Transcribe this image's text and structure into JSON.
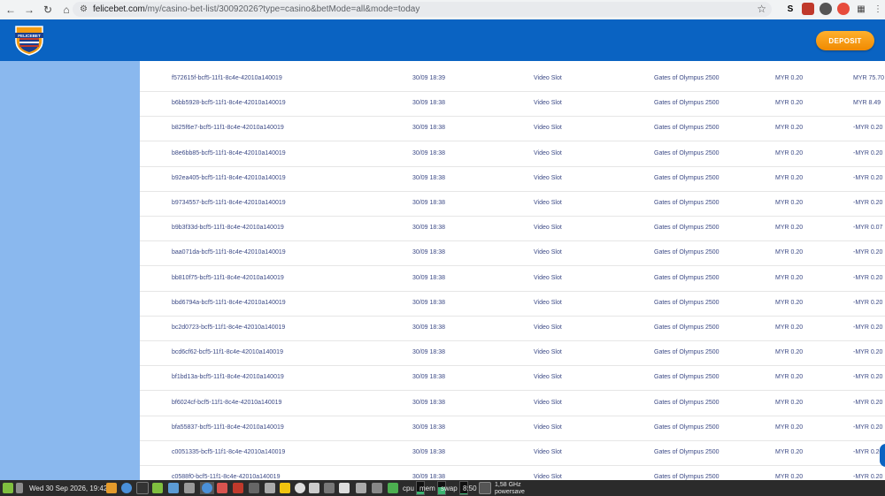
{
  "browser": {
    "url_host": "felicebet.com",
    "url_rest": "/my/casino-bet-list/30092026?type=casino&betMode=all&mode=today"
  },
  "header": {
    "logo_text": "FELICEBET",
    "deposit_label": "DEPOSIT"
  },
  "table": {
    "rows": [
      {
        "id": "f572615f-bcf5-11f1-8c4e-42010a140019",
        "time": "30/09 18:39",
        "type": "Video Slot",
        "game": "Gates of Olympus 2500",
        "bet": "MYR 0.20",
        "win": "MYR 75.70"
      },
      {
        "id": "b6bb5928-bcf5-11f1-8c4e-42010a140019",
        "time": "30/09 18:38",
        "type": "Video Slot",
        "game": "Gates of Olympus 2500",
        "bet": "MYR 0.20",
        "win": "MYR 8.49"
      },
      {
        "id": "b825f6e7-bcf5-11f1-8c4e-42010a140019",
        "time": "30/09 18:38",
        "type": "Video Slot",
        "game": "Gates of Olympus 2500",
        "bet": "MYR 0.20",
        "win": "-MYR 0.20"
      },
      {
        "id": "b8e6bb85-bcf5-11f1-8c4e-42010a140019",
        "time": "30/09 18:38",
        "type": "Video Slot",
        "game": "Gates of Olympus 2500",
        "bet": "MYR 0.20",
        "win": "-MYR 0.20"
      },
      {
        "id": "b92ea405-bcf5-11f1-8c4e-42010a140019",
        "time": "30/09 18:38",
        "type": "Video Slot",
        "game": "Gates of Olympus 2500",
        "bet": "MYR 0.20",
        "win": "-MYR 0.20"
      },
      {
        "id": "b9734557-bcf5-11f1-8c4e-42010a140019",
        "time": "30/09 18:38",
        "type": "Video Slot",
        "game": "Gates of Olympus 2500",
        "bet": "MYR 0.20",
        "win": "-MYR 0.20"
      },
      {
        "id": "b9b3f33d-bcf5-11f1-8c4e-42010a140019",
        "time": "30/09 18:38",
        "type": "Video Slot",
        "game": "Gates of Olympus 2500",
        "bet": "MYR 0.20",
        "win": "-MYR 0.07"
      },
      {
        "id": "baa071da-bcf5-11f1-8c4e-42010a140019",
        "time": "30/09 18:38",
        "type": "Video Slot",
        "game": "Gates of Olympus 2500",
        "bet": "MYR 0.20",
        "win": "-MYR 0.20"
      },
      {
        "id": "bb810f75-bcf5-11f1-8c4e-42010a140019",
        "time": "30/09 18:38",
        "type": "Video Slot",
        "game": "Gates of Olympus 2500",
        "bet": "MYR 0.20",
        "win": "-MYR 0.20"
      },
      {
        "id": "bbd6794a-bcf5-11f1-8c4e-42010a140019",
        "time": "30/09 18:38",
        "type": "Video Slot",
        "game": "Gates of Olympus 2500",
        "bet": "MYR 0.20",
        "win": "-MYR 0.20"
      },
      {
        "id": "bc2d0723-bcf5-11f1-8c4e-42010a140019",
        "time": "30/09 18:38",
        "type": "Video Slot",
        "game": "Gates of Olympus 2500",
        "bet": "MYR 0.20",
        "win": "-MYR 0.20"
      },
      {
        "id": "bcd6cf62-bcf5-11f1-8c4e-42010a140019",
        "time": "30/09 18:38",
        "type": "Video Slot",
        "game": "Gates of Olympus 2500",
        "bet": "MYR 0.20",
        "win": "-MYR 0.20"
      },
      {
        "id": "bf1bd13a-bcf5-11f1-8c4e-42010a140019",
        "time": "30/09 18:38",
        "type": "Video Slot",
        "game": "Gates of Olympus 2500",
        "bet": "MYR 0.20",
        "win": "-MYR 0.20"
      },
      {
        "id": "bf6024cf-bcf5-11f1-8c4e-42010a140019",
        "time": "30/09 18:38",
        "type": "Video Slot",
        "game": "Gates of Olympus 2500",
        "bet": "MYR 0.20",
        "win": "-MYR 0.20"
      },
      {
        "id": "bfa55837-bcf5-11f1-8c4e-42010a140019",
        "time": "30/09 18:38",
        "type": "Video Slot",
        "game": "Gates of Olympus 2500",
        "bet": "MYR 0.20",
        "win": "-MYR 0.20"
      },
      {
        "id": "c0051335-bcf5-11f1-8c4e-42010a140019",
        "time": "30/09 18:38",
        "type": "Video Slot",
        "game": "Gates of Olympus 2500",
        "bet": "MYR 0.20",
        "win": "-MYR 0.20"
      },
      {
        "id": "c0588f0-bcf5-11f1-8c4e-42010a140019",
        "time": "30/09 18:38",
        "type": "Video Slot",
        "game": "Gates of Olympus 2500",
        "bet": "MYR 0.20",
        "win": "-MYR 0.20"
      }
    ]
  },
  "taskbar": {
    "datetime": "Wed 30 Sep 2026, 19:42",
    "cpu_label": "cpu",
    "mem_label": "mem",
    "swap_label": "swap",
    "clock": "8:50",
    "freq": "1,58 GHz",
    "governor": "powersave"
  },
  "colors": {
    "header_blue": "#0a63c2",
    "sidebar_blue": "#8ab8ee",
    "deposit_orange": "#f5a623"
  }
}
